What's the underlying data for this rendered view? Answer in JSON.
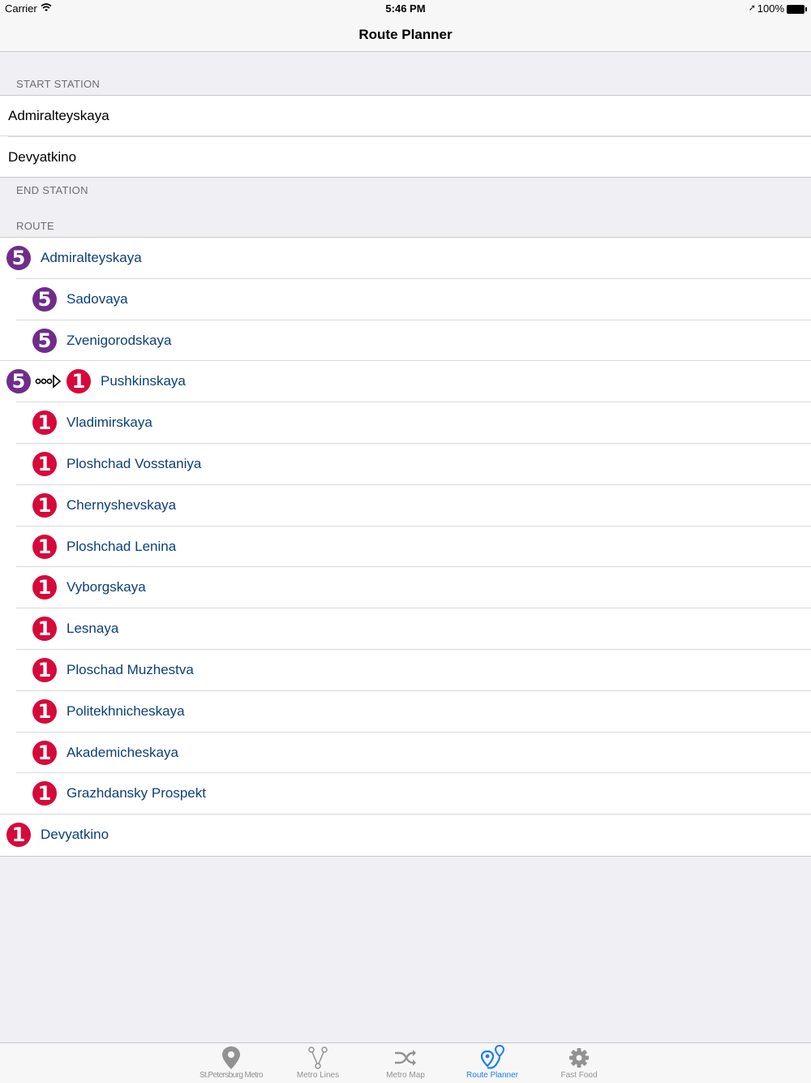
{
  "status_bar": {
    "carrier": "Carrier",
    "time": "5:46 PM",
    "battery": "100%"
  },
  "nav": {
    "title": "Route Planner"
  },
  "sections": {
    "start": "START STATION",
    "end": "END STATION",
    "route": "ROUTE"
  },
  "start_station": "Admiralteyskaya",
  "end_station": "Devyatkino",
  "route": [
    {
      "line": "5",
      "name": "Admiralteyskaya",
      "kind": "endpoint"
    },
    {
      "line": "5",
      "name": "Sadovaya",
      "kind": "stop"
    },
    {
      "line": "5",
      "name": "Zvenigorodskaya",
      "kind": "stop"
    },
    {
      "line": "1",
      "from_line": "5",
      "name": "Pushkinskaya",
      "kind": "transfer"
    },
    {
      "line": "1",
      "name": "Vladimirskaya",
      "kind": "stop"
    },
    {
      "line": "1",
      "name": "Ploshchad Vosstaniya",
      "kind": "stop"
    },
    {
      "line": "1",
      "name": "Chernyshevskaya",
      "kind": "stop"
    },
    {
      "line": "1",
      "name": "Ploshchad Lenina",
      "kind": "stop"
    },
    {
      "line": "1",
      "name": "Vyborgskaya",
      "kind": "stop"
    },
    {
      "line": "1",
      "name": "Lesnaya",
      "kind": "stop"
    },
    {
      "line": "1",
      "name": "Ploschad Muzhestva",
      "kind": "stop"
    },
    {
      "line": "1",
      "name": "Politekhnicheskaya",
      "kind": "stop"
    },
    {
      "line": "1",
      "name": "Akademicheskaya",
      "kind": "stop"
    },
    {
      "line": "1",
      "name": "Grazhdansky Prospekt",
      "kind": "stop"
    },
    {
      "line": "1",
      "name": "Devyatkino",
      "kind": "endpoint"
    }
  ],
  "line_colors": {
    "1": "#d6093b",
    "5": "#6f2d8a"
  },
  "tabs": [
    {
      "label": "St.Petersburg Metro",
      "icon": "map-pin-icon",
      "active": false
    },
    {
      "label": "Metro Lines",
      "icon": "branch-lines-icon",
      "active": false
    },
    {
      "label": "Metro Map",
      "icon": "shuffle-icon",
      "active": false
    },
    {
      "label": "Route Planner",
      "icon": "route-pins-icon",
      "active": true
    },
    {
      "label": "Fast Food",
      "icon": "gear-icon",
      "active": false
    }
  ],
  "colors": {
    "accent": "#1b7cf5",
    "station_text": "#0b3f7a",
    "background": "#efeff4"
  }
}
